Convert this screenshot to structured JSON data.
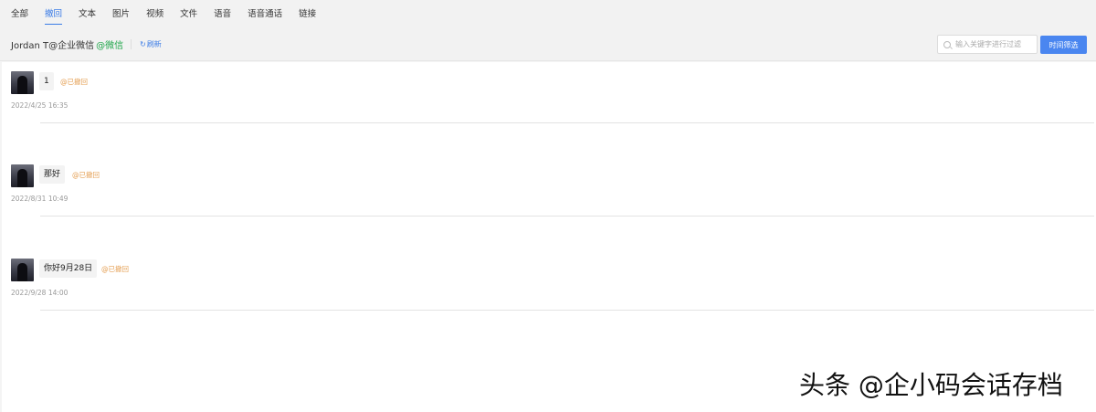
{
  "tabs": [
    {
      "label": "全部"
    },
    {
      "label": "撤回"
    },
    {
      "label": "文本"
    },
    {
      "label": "图片"
    },
    {
      "label": "视频"
    },
    {
      "label": "文件"
    },
    {
      "label": "语音"
    },
    {
      "label": "语音通话"
    },
    {
      "label": "链接"
    }
  ],
  "active_tab": "撤回",
  "contact": {
    "name": "Jordan T@企业微信",
    "platform": "@微信",
    "refresh_label": "刷新"
  },
  "search": {
    "placeholder": "输入关键字进行过滤"
  },
  "filter_button": "时间筛选",
  "messages": [
    {
      "text": "1",
      "status": "@已撤回",
      "time": "2022/4/25 16:35"
    },
    {
      "text": "那好",
      "status": "@已撤回",
      "time": "2022/8/31 10:49"
    },
    {
      "text": "你好9月28日",
      "status": "@已撤回",
      "time": "2022/9/28 14:00"
    }
  ],
  "watermark": "头条 @企小码会话存档",
  "colors": {
    "accent": "#3b7ce6",
    "platform": "#20a64a",
    "recalled": "#e5a055",
    "button": "#4a86f0"
  }
}
